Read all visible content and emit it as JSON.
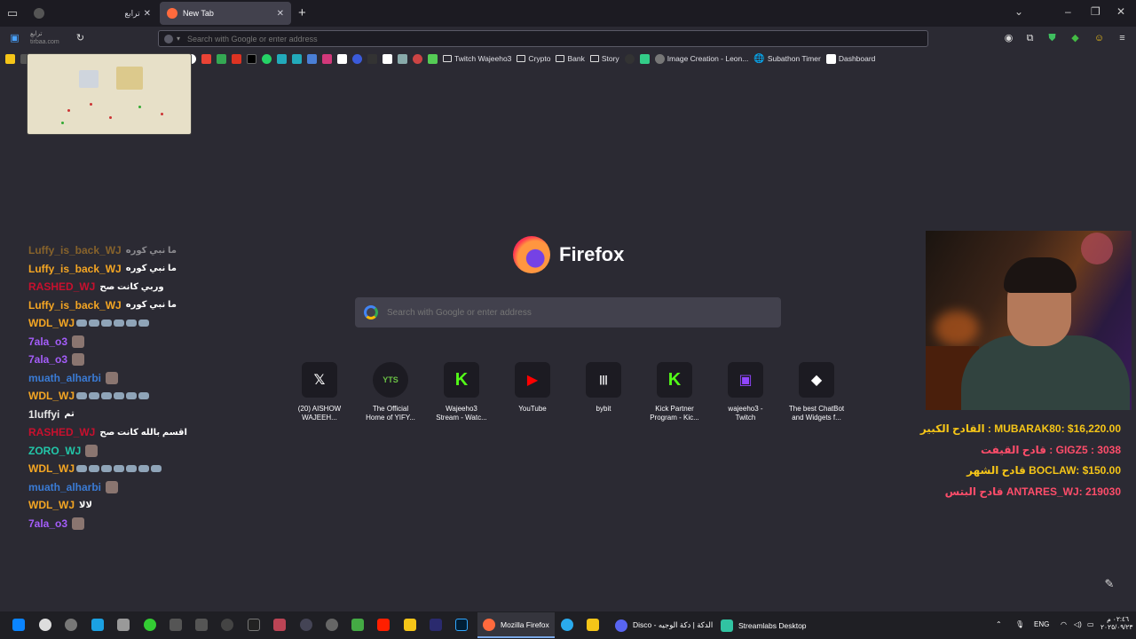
{
  "tabs": [
    {
      "title": "ترابع",
      "active": false
    },
    {
      "title": "New Tab",
      "active": true
    }
  ],
  "thumb": {
    "title": "ترابع",
    "url": "tirbaa.com"
  },
  "url_bar": {
    "placeholder": "Search with Google or enter address"
  },
  "bookmarks": [
    {
      "label": "Twitch Wajeeho3",
      "icon": "folder-icon"
    },
    {
      "label": "Crypto",
      "icon": "folder-icon"
    },
    {
      "label": "Bank",
      "icon": "folder-icon"
    },
    {
      "label": "Story",
      "icon": "folder-icon"
    },
    {
      "label": "Image Creation - Leon...",
      "icon": "site-icon"
    },
    {
      "label": "Subathon Timer",
      "icon": "globe-icon"
    },
    {
      "label": "Dashboard",
      "icon": "site-icon"
    }
  ],
  "newtab": {
    "brand": "Firefox",
    "search_placeholder": "Search with Google or enter address",
    "tiles": [
      {
        "label": "(20) AISHOW\nWAJEEH...",
        "icon": "𝕏",
        "color": "#ffffff"
      },
      {
        "label": "The Official\nHome of YIFY...",
        "icon": "YTS",
        "color": "#6ac045"
      },
      {
        "label": "Wajeeho3\nStream - Watc...",
        "icon": "K",
        "color": "#53fc18"
      },
      {
        "label": "YouTube",
        "icon": "▶",
        "color": "#ff0000"
      },
      {
        "label": "bybit",
        "icon": "|||",
        "color": "#ffffff"
      },
      {
        "label": "Kick Partner\nProgram - Kic...",
        "icon": "K",
        "color": "#53fc18"
      },
      {
        "label": "wajeeho3 -\nTwitch",
        "icon": "▣",
        "color": "#9146ff"
      },
      {
        "label": "The best ChatBot\nand Widgets f...",
        "icon": "◆",
        "color": "#ffffff"
      }
    ]
  },
  "chat": [
    {
      "user": "Luffy_is_back_WJ",
      "text": "ما نبي كوره",
      "color": "#f5a623",
      "faded": true,
      "emotes": 0
    },
    {
      "user": "Luffy_is_back_WJ",
      "text": "ما نبي كوره",
      "color": "#f5a623",
      "faded": false,
      "emotes": 0
    },
    {
      "user": "RASHED_WJ",
      "text": "وربي كانت صح",
      "color": "#c8102e",
      "faded": false,
      "emotes": 0
    },
    {
      "user": "Luffy_is_back_WJ",
      "text": "ما نبي كوره",
      "color": "#f5a623",
      "faded": false,
      "emotes": 0
    },
    {
      "user": "WDL_WJ",
      "text": "",
      "color": "#f5a623",
      "faded": false,
      "emotes": 6
    },
    {
      "user": "7ala_o3",
      "text": "",
      "color": "#a45dfa",
      "faded": false,
      "emotes": 1
    },
    {
      "user": "7ala_o3",
      "text": "",
      "color": "#a45dfa",
      "faded": false,
      "emotes": 1
    },
    {
      "user": "muath_alharbi",
      "text": "",
      "color": "#3a7bd5",
      "faded": false,
      "emotes": 1
    },
    {
      "user": "WDL_WJ",
      "text": "",
      "color": "#f5a623",
      "faded": false,
      "emotes": 6
    },
    {
      "user": "1luffyi",
      "text": "تم",
      "color": "#e8e8e8",
      "faded": false,
      "emotes": 0
    },
    {
      "user": "RASHED_WJ",
      "text": "اقسم بالله كانت صح",
      "color": "#c8102e",
      "faded": false,
      "emotes": 0
    },
    {
      "user": "ZORO_WJ",
      "text": "",
      "color": "#22c7a9",
      "faded": false,
      "emotes": 1
    },
    {
      "user": "WDL_WJ",
      "text": "",
      "color": "#f5a623",
      "faded": false,
      "emotes": 7
    },
    {
      "user": "muath_alharbi",
      "text": "",
      "color": "#3a7bd5",
      "faded": false,
      "emotes": 1
    },
    {
      "user": "WDL_WJ",
      "text": "لالا",
      "color": "#f5a623",
      "faded": false,
      "emotes": 0
    },
    {
      "user": "7ala_o3",
      "text": "",
      "color": "#a45dfa",
      "faded": false,
      "emotes": 1
    }
  ],
  "leaderboard": [
    {
      "text": "القادح الكبير : MUBARAK80: $16,220.00",
      "color": "#f5c518"
    },
    {
      "text": "قادح القيفت : GIGZ5 : 3038",
      "color": "#ff4d6a"
    },
    {
      "text": "قادح الشهر BOCLAW: $150.00",
      "color": "#f5c518"
    },
    {
      "text": "قادح البتس ANTARES_WJ: 219030",
      "color": "#ff4d6a"
    }
  ],
  "taskbar": {
    "apps": [
      {
        "label": "Mozilla Firefox",
        "active": true
      },
      {
        "label": "Disco - الدكة | دكة الوجيه",
        "active": false
      },
      {
        "label": "Streamlabs Desktop",
        "active": false
      }
    ],
    "lang": "ENG",
    "time": "٠٢:٤٦ م",
    "date": "٢٠٢٥/٠٩/٢٣"
  }
}
